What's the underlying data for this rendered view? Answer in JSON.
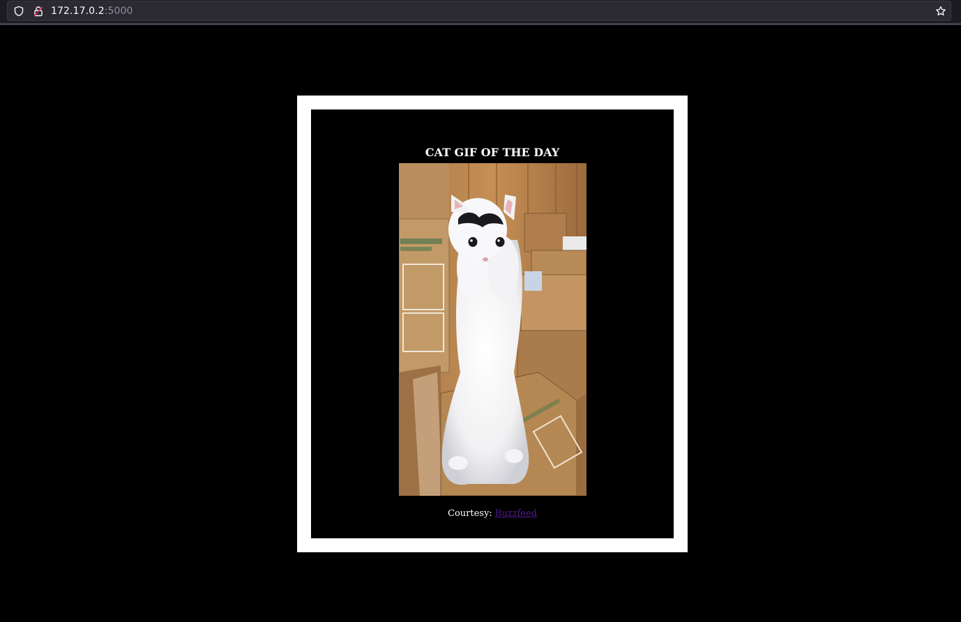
{
  "browser": {
    "url_host": "172.17.0.2",
    "url_port": ":5000",
    "icons": [
      "shield-icon",
      "lock-icon",
      "star-icon"
    ]
  },
  "page": {
    "title": "CAT GIF OF THE DAY",
    "image_alt": "cat gif",
    "courtesy_label": "Courtesy: ",
    "courtesy_link": "Buzzfeed",
    "link_color": "#551a8b",
    "background_color": "#000000",
    "frame_color": "#ffffff"
  }
}
